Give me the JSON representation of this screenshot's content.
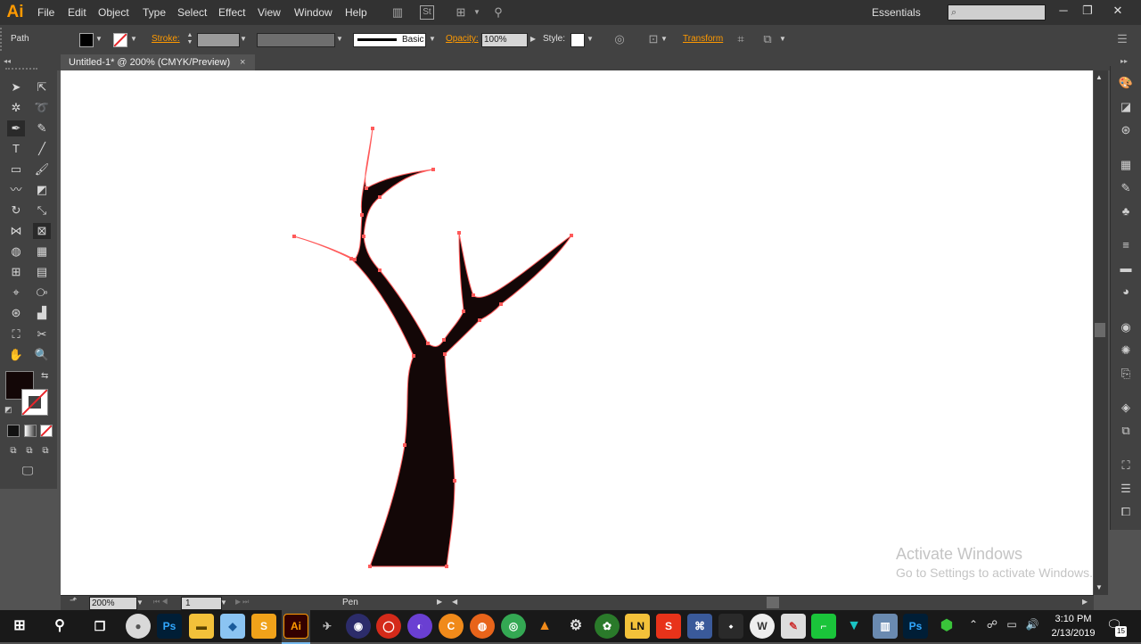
{
  "app": {
    "logo": "Ai"
  },
  "menu": [
    "File",
    "Edit",
    "Object",
    "Type",
    "Select",
    "Effect",
    "View",
    "Window",
    "Help"
  ],
  "menubar": {
    "workspace": "Essentials"
  },
  "control": {
    "selection_label": "Path",
    "stroke_label": "Stroke:",
    "brush_label": "Basic",
    "opacity_label": "Opacity:",
    "opacity_value": "100%",
    "style_label": "Style:",
    "transform_label": "Transform"
  },
  "document": {
    "tab_title": "Untitled-1* @ 200% (CMYK/Preview)"
  },
  "canvas": {
    "fill_color": "#130707",
    "stroke_color": "#ff5a5a"
  },
  "statusbar": {
    "zoom": "200%",
    "artboard": "1",
    "current_tool": "Pen"
  },
  "watermark": {
    "line1": "Activate Windows",
    "line2": "Go to Settings to activate Windows."
  },
  "taskbar": {
    "apps": [
      "Ps",
      "Ai",
      "C",
      "LN",
      "S",
      "Ps"
    ],
    "time": "3:10 PM",
    "date": "2/13/2019",
    "notification_count": "15"
  }
}
